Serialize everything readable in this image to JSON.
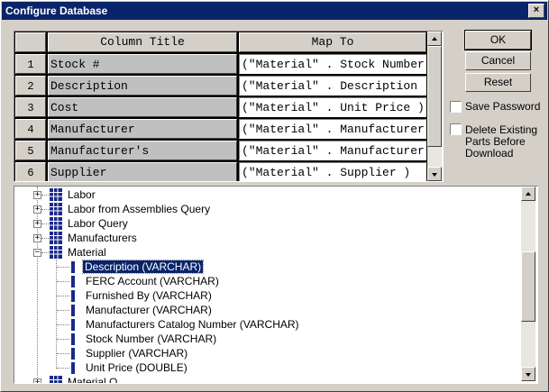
{
  "window": {
    "title": "Configure Database",
    "close_glyph": "×"
  },
  "mapping_table": {
    "headers": [
      "Column Title",
      "Map To"
    ],
    "rows": [
      {
        "num": "1",
        "title": "Stock #",
        "map": "(\"Material\" . Stock Number"
      },
      {
        "num": "2",
        "title": "Description",
        "map": "(\"Material\" . Description"
      },
      {
        "num": "3",
        "title": "Cost",
        "map": "(\"Material\" . Unit Price )"
      },
      {
        "num": "4",
        "title": "Manufacturer",
        "map": "(\"Material\" . Manufacturer"
      },
      {
        "num": "5",
        "title": "Manufacturer's",
        "map": "(\"Material\" . Manufacturer"
      },
      {
        "num": "6",
        "title": "Supplier",
        "map": "(\"Material\" . Supplier )"
      }
    ]
  },
  "buttons": {
    "ok": "OK",
    "cancel": "Cancel",
    "reset": "Reset"
  },
  "options": {
    "save_password": {
      "label": "Save Password",
      "checked": false
    },
    "delete_existing": {
      "label": "Delete Existing Parts Before Download",
      "checked": false
    }
  },
  "tree": {
    "tables": [
      {
        "label": "Labor",
        "expanded": false
      },
      {
        "label": "Labor from Assemblies Query",
        "expanded": false
      },
      {
        "label": "Labor Query",
        "expanded": false
      },
      {
        "label": "Manufacturers",
        "expanded": false
      },
      {
        "label": "Material",
        "expanded": true
      },
      {
        "label": "Material Q...",
        "expanded": false
      }
    ],
    "material_columns": [
      {
        "label": "Description (VARCHAR)",
        "selected": true
      },
      {
        "label": "FERC Account (VARCHAR)",
        "selected": false
      },
      {
        "label": "Furnished By (VARCHAR)",
        "selected": false
      },
      {
        "label": "Manufacturer (VARCHAR)",
        "selected": false
      },
      {
        "label": "Manufacturers Catalog Number (VARCHAR)",
        "selected": false
      },
      {
        "label": "Stock Number (VARCHAR)",
        "selected": false
      },
      {
        "label": "Supplier (VARCHAR)",
        "selected": false
      },
      {
        "label": "Unit Price (DOUBLE)",
        "selected": false
      }
    ]
  },
  "colors": {
    "title_bar": "#0a246a",
    "selection": "#0a246a",
    "face": "#d4d0c8",
    "column_icon": "#1a2a8a"
  },
  "icons": {
    "table": "table-grid-icon",
    "column": "column-field-icon",
    "expand": "plus",
    "collapse": "minus"
  }
}
